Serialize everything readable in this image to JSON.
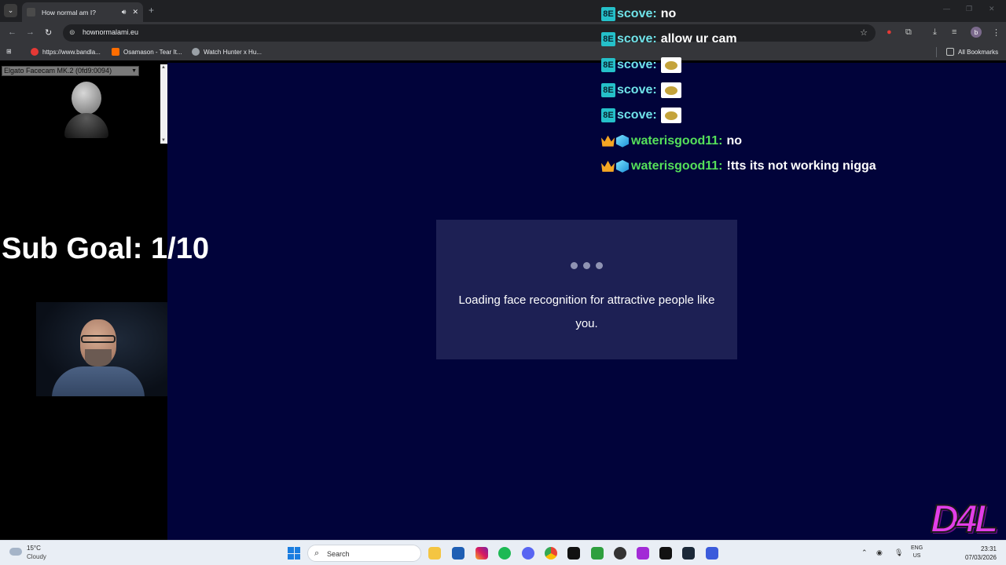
{
  "browser": {
    "tab_title": "How normal am I?",
    "new_tab_symbol": "+",
    "url": "hownormalami.eu",
    "bookmarks": [
      {
        "label": "https://www.bandla..."
      },
      {
        "label": "Osamason - Tear It..."
      },
      {
        "label": "Watch Hunter x Hu..."
      }
    ],
    "all_bookmarks": "All Bookmarks",
    "profile_initial": "b"
  },
  "overlay": {
    "camera_select": "Elgato Facecam MK.2 (0fd9:0094)",
    "sub_goal": "Sub Goal: 1/10",
    "logo_text": "D4L"
  },
  "page": {
    "loading_text": "Loading face recognition for attractive people like you."
  },
  "chat": {
    "messages": [
      {
        "user": "scove:",
        "text": "no"
      },
      {
        "user": "scove:",
        "text": "allow ur cam"
      },
      {
        "user": "scove:",
        "text": ""
      },
      {
        "user": "scove:",
        "text": ""
      },
      {
        "user": "scove:",
        "text": ""
      },
      {
        "user": "waterisgood11:",
        "text": "no"
      },
      {
        "user": "waterisgood11:",
        "text": "!tts its not working nigga"
      }
    ]
  },
  "taskbar": {
    "weather_temp": "15°C",
    "weather_desc": "Cloudy",
    "search_placeholder": "Search",
    "lang_line1": "ENG",
    "lang_line2": "US",
    "time": "23:31",
    "date": "07/03/2026"
  },
  "colors": {
    "page_bg": "#01033a",
    "card_bg": "#1d2054",
    "chat_user_scove": "#6fe2e8",
    "chat_user_water": "#55e05a",
    "logo": "#e23ee8"
  }
}
